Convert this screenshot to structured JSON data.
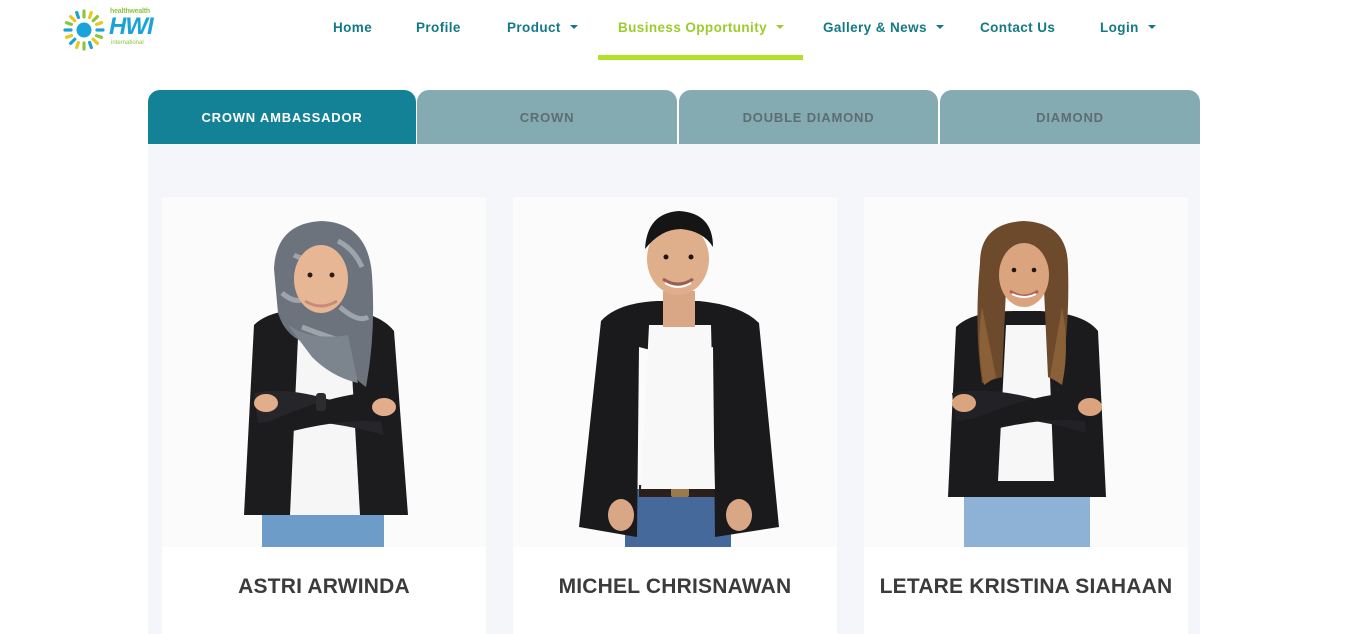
{
  "brand": {
    "tagline": "healthwealth",
    "wordmark": "HWI",
    "sub": "international",
    "colors": {
      "blue": "#1aa3d8",
      "green": "#8cc63f",
      "yellow": "#e8c81e"
    }
  },
  "nav": {
    "items": [
      {
        "label": "Home",
        "dropdown": false,
        "active": false
      },
      {
        "label": "Profile",
        "dropdown": false,
        "active": false
      },
      {
        "label": "Product",
        "dropdown": true,
        "active": false
      },
      {
        "label": "Business Opportunity",
        "dropdown": true,
        "active": true
      },
      {
        "label": "Gallery & News",
        "dropdown": true,
        "active": false
      },
      {
        "label": "Contact Us",
        "dropdown": false,
        "active": false
      },
      {
        "label": "Login",
        "dropdown": true,
        "active": false
      }
    ],
    "color": "#127a86",
    "active_color": "#9ccc2c"
  },
  "tabs": {
    "items": [
      {
        "label": "CROWN AMBASSADOR",
        "selected": true
      },
      {
        "label": "CROWN",
        "selected": false
      },
      {
        "label": "DOUBLE DIAMOND",
        "selected": false
      },
      {
        "label": "DIAMOND",
        "selected": false
      }
    ],
    "selected_color": "#138297",
    "unselected_color": "#84aab2"
  },
  "members": [
    {
      "name": "ASTRI ARWINDA",
      "photo": "woman-in-hijab-arms-crossed"
    },
    {
      "name": "MICHEL CHRISNAWAN",
      "photo": "man-in-black-blazer"
    },
    {
      "name": "LETARE KRISTINA SIAHAAN",
      "photo": "woman-in-black-blazer-arms-crossed"
    }
  ]
}
